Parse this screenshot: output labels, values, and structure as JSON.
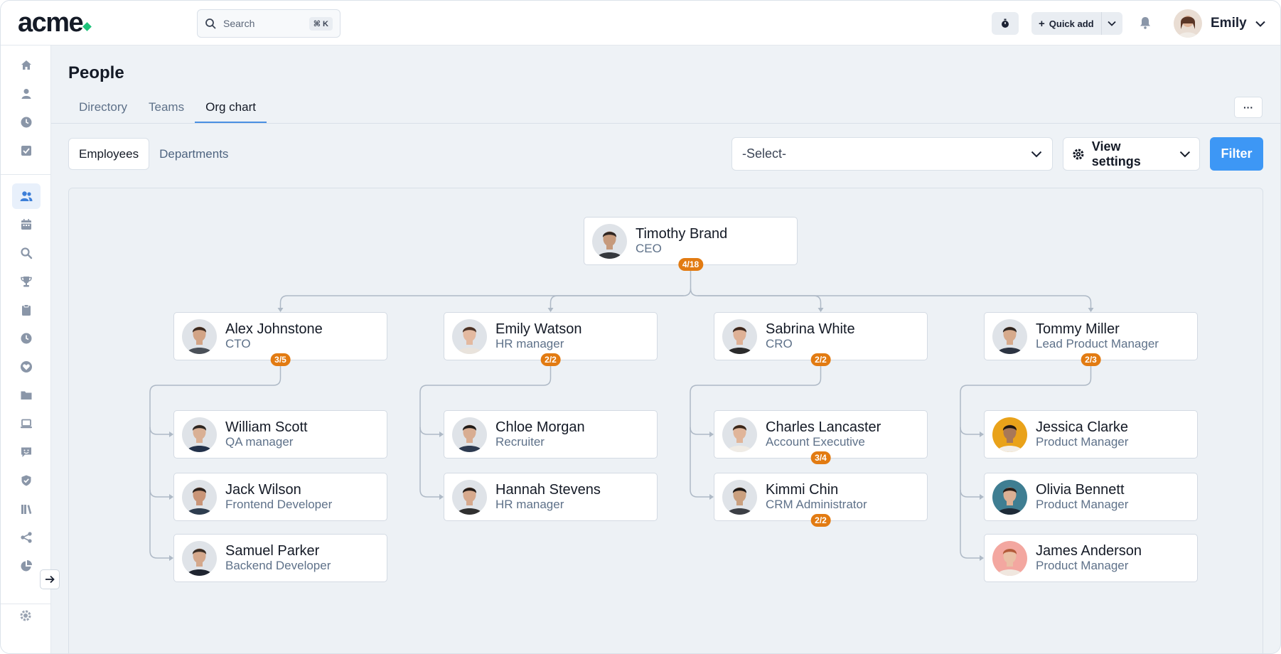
{
  "app": {
    "logo": "acme",
    "search_placeholder": "Search",
    "search_shortcut": "⌘ K",
    "quick_add_label": "Quick add",
    "user_name": "Emily"
  },
  "sidebar": {
    "items": [
      "home-icon",
      "person-icon",
      "clock-icon",
      "checkbox-icon",
      "people-icon",
      "calendar-icon",
      "search-icon",
      "trophy-icon",
      "clipboard-icon",
      "clock-icon",
      "heart-icon",
      "folder-icon",
      "laptop-icon",
      "chat-smile-icon",
      "shield-check-icon",
      "books-icon",
      "share-icon",
      "pie-chart-icon"
    ],
    "active_index": 4
  },
  "page": {
    "title": "People",
    "tabs": [
      {
        "label": "Directory",
        "active": false
      },
      {
        "label": "Teams",
        "active": false
      },
      {
        "label": "Org chart",
        "active": true
      }
    ],
    "more_label": "···"
  },
  "toolbar": {
    "segments": [
      "Employees",
      "Departments"
    ],
    "active_segment": 0,
    "select_value": "-Select-",
    "view_settings_label": "View settings",
    "filter_label": "Filter"
  },
  "org": {
    "ceo": {
      "name": "Timothy Brand",
      "role": "CEO",
      "badge": "4/18",
      "skin": "#c69a7c",
      "hair": "#2f2622",
      "shirt": "#35383d"
    },
    "reports": [
      {
        "name": "Alex Johnstone",
        "role": "CTO",
        "badge": "3/5",
        "skin": "#d2a486",
        "hair": "#3b2a20",
        "shirt": "#4a5058",
        "team": [
          {
            "name": "William Scott",
            "role": "QA manager",
            "badge": "",
            "skin": "#d9b095",
            "hair": "#2c2521",
            "shirt": "#22314a"
          },
          {
            "name": "Jack Wilson",
            "role": "Frontend Developer",
            "badge": "",
            "skin": "#c99578",
            "hair": "#2a211c",
            "shirt": "#2e3d4f"
          },
          {
            "name": "Samuel Parker",
            "role": "Backend Developer",
            "badge": "",
            "skin": "#d4a88c",
            "hair": "#3a2e26",
            "shirt": "#1f2430"
          }
        ]
      },
      {
        "name": "Emily Watson",
        "role": "HR manager",
        "badge": "2/2",
        "skin": "#e3b9a0",
        "hair": "#4a3226",
        "shirt": "#e9e3dc",
        "team": [
          {
            "name": "Chloe Morgan",
            "role": "Recruiter",
            "badge": "",
            "skin": "#d8ad92",
            "hair": "#1f1a17",
            "shirt": "#2d3a50"
          },
          {
            "name": "Hannah Stevens",
            "role": "HR manager",
            "badge": "",
            "skin": "#d6a98d",
            "hair": "#241c18",
            "shirt": "#303030"
          }
        ]
      },
      {
        "name": "Sabrina White",
        "role": "CRO",
        "badge": "2/2",
        "skin": "#deb196",
        "hair": "#3b271d",
        "shirt": "#2b2b2b",
        "team": [
          {
            "name": "Charles Lancaster",
            "role": "Account Executive",
            "badge": "3/4",
            "skin": "#e0b59a",
            "hair": "#3a2619",
            "shirt": "#f0ece6"
          },
          {
            "name": "Kimmi Chin",
            "role": "CRM Administrator",
            "badge": "2/2",
            "skin": "#caa07f",
            "hair": "#1c1816",
            "shirt": "#3c3f45"
          }
        ]
      },
      {
        "name": "Tommy Miller",
        "role": "Lead Product Manager",
        "badge": "2/3",
        "skin": "#d6aa8c",
        "hair": "#2e2520",
        "shirt": "#2c3442",
        "team": [
          {
            "name": "Jessica Clarke",
            "role": "Product Manager",
            "badge": "",
            "skin": "#a87858",
            "hair": "#1f1610",
            "shirt": "#f2ede6",
            "bg": "#e9a21a"
          },
          {
            "name": "Olivia Bennett",
            "role": "Product Manager",
            "badge": "",
            "skin": "#dcb094",
            "hair": "#2a1e18",
            "shirt": "#1f2b38",
            "bg": "#3f7e92"
          },
          {
            "name": "James Anderson",
            "role": "Product Manager",
            "badge": "",
            "skin": "#eac0a6",
            "hair": "#b35a3a",
            "shirt": "#f0e7df",
            "bg": "#f3a7a0"
          }
        ]
      }
    ]
  },
  "colors": {
    "accent": "#3d97f5",
    "badge": "#e27b12",
    "logo_dot": "#1ec27a"
  }
}
